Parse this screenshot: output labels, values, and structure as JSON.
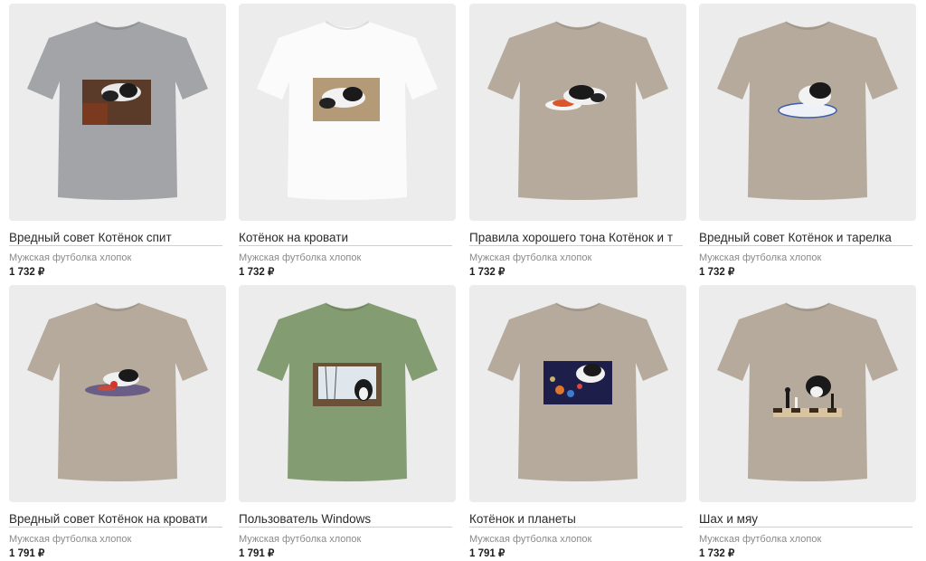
{
  "products": [
    {
      "title": "Вредный совет Котёнок спит",
      "subtitle": "Мужская футболка хлопок",
      "price": "1 732 ₽",
      "shirt_color": "#a3a4a7",
      "print": "cat-sleeping-sofa"
    },
    {
      "title": "Котёнок на кровати",
      "subtitle": "Мужская футболка хлопок",
      "price": "1 732 ₽",
      "shirt_color": "#fbfbfb",
      "print": "cat-on-bed"
    },
    {
      "title": "Правила хорошего тона Котёнок и т",
      "subtitle": "Мужская футболка хлопок",
      "price": "1 732 ₽",
      "shirt_color": "#b5aa9c",
      "print": "cat-with-plate"
    },
    {
      "title": "Вредный совет Котёнок и тарелка",
      "subtitle": "Мужская футболка хлопок",
      "price": "1 732 ₽",
      "shirt_color": "#b5aa9c",
      "print": "cat-in-bowl"
    },
    {
      "title": "Вредный совет Котёнок на кровати",
      "subtitle": "Мужская футболка хлопок",
      "price": "1 791 ₽",
      "shirt_color": "#b5aa9c",
      "print": "cat-on-blanket"
    },
    {
      "title": "Пользователь Windows",
      "subtitle": "Мужская футболка хлопок",
      "price": "1 791 ₽",
      "shirt_color": "#849c72",
      "print": "cat-at-window"
    },
    {
      "title": "Котёнок и планеты",
      "subtitle": "Мужская футболка хлопок",
      "price": "1 791 ₽",
      "shirt_color": "#b5aa9c",
      "print": "cat-and-planets"
    },
    {
      "title": "Шах и мяу",
      "subtitle": "Мужская футболка хлопок",
      "price": "1 732 ₽",
      "shirt_color": "#b5aa9c",
      "print": "cat-chess"
    }
  ]
}
